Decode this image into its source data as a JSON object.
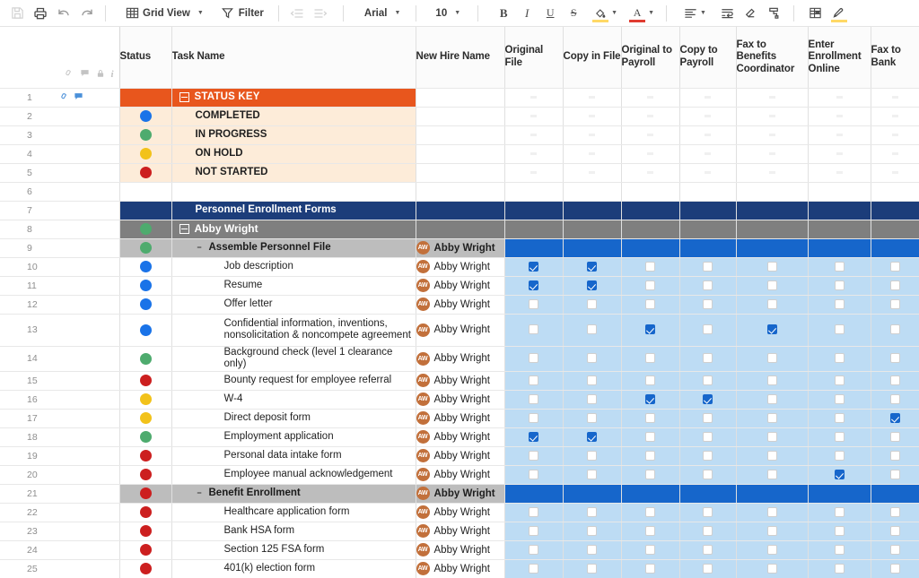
{
  "toolbar": {
    "icons": [
      {
        "name": "save-icon",
        "glyph": "💾"
      },
      {
        "name": "print-icon",
        "glyph": "⎙"
      },
      {
        "name": "undo-icon",
        "glyph": "↶"
      },
      {
        "name": "redo-icon",
        "glyph": "↷"
      }
    ],
    "view_label": "Grid View",
    "filter_label": "Filter",
    "indent_decrease_label": "Decrease indent",
    "indent_increase_label": "Increase indent",
    "font_family_label": "Arial",
    "font_size_label": "10",
    "bold_label": "B",
    "italic_label": "I",
    "underline_label": "U",
    "strikethrough_label": "S",
    "fill_color_label": "Fill color",
    "text_color_label": "Text color",
    "align_label": "Align",
    "wrap_label": "Wrap text",
    "clear_format_label": "Clear format",
    "format_painter_label": "Format painter",
    "card_view_label": "Card view",
    "highlight_label": "Highlighter"
  },
  "columns": [
    {
      "key": "gutter",
      "label": ""
    },
    {
      "key": "status",
      "label": "Status"
    },
    {
      "key": "task",
      "label": "Task Name"
    },
    {
      "key": "hire",
      "label": "New Hire Name"
    },
    {
      "key": "c1",
      "label": "Original File"
    },
    {
      "key": "c2",
      "label": "Copy in File"
    },
    {
      "key": "c3",
      "label": "Original to Payroll"
    },
    {
      "key": "c4",
      "label": "Copy to Payroll"
    },
    {
      "key": "c5",
      "label": "Fax to Benefits Coordinator"
    },
    {
      "key": "c6",
      "label": "Enter Enrollment Online"
    },
    {
      "key": "c7",
      "label": "Fax to Bank"
    }
  ],
  "gutter_header_icons": [
    "attachment-icon",
    "comment-icon",
    "lock-icon",
    "info-icon"
  ],
  "status_colors": {
    "completed": "#1a73e8",
    "in_progress": "#4eab6e",
    "on_hold": "#f2c21a",
    "not_started": "#cc1f1f"
  },
  "theme": {
    "orange_header": "#e8561d",
    "key_background": "#fdecd9",
    "navy_section": "#1c3d7a",
    "gray_section": "#7f7f7f",
    "light_gray_section": "#bdbdbd",
    "accent_blue": "#1666cb",
    "row_blue": "#bddcf4",
    "avatar_color": "#c2703b"
  },
  "rows": [
    {
      "num": "1",
      "theme": "r-orange",
      "icons": [
        "attachment-icon",
        "comment-icon"
      ],
      "toggle": "boxed-minus",
      "indent": 0,
      "task": "STATUS KEY",
      "status": null,
      "hire": null,
      "checks": "dash"
    },
    {
      "num": "2",
      "theme": "r-key",
      "indent": 1,
      "task": "COMPLETED",
      "status": "completed",
      "hire": null,
      "checks": "dash"
    },
    {
      "num": "3",
      "theme": "r-key",
      "indent": 1,
      "task": "IN PROGRESS",
      "status": "in_progress",
      "hire": null,
      "checks": "dash"
    },
    {
      "num": "4",
      "theme": "r-key",
      "indent": 1,
      "task": "ON HOLD",
      "status": "on_hold",
      "hire": null,
      "checks": "dash"
    },
    {
      "num": "5",
      "theme": "r-key",
      "indent": 1,
      "task": "NOT STARTED",
      "status": "not_started",
      "hire": null,
      "checks": "dash"
    },
    {
      "num": "6",
      "theme": "r-blank",
      "indent": 0,
      "task": "",
      "status": null,
      "hire": null,
      "checks": "none"
    },
    {
      "num": "7",
      "theme": "r-navy",
      "indent": 1,
      "task": "Personnel Enrollment Forms",
      "status": null,
      "hire": null,
      "checks": "none"
    },
    {
      "num": "8",
      "theme": "r-gray",
      "toggle": "boxed-minus",
      "indent": 0,
      "task": "Abby Wright",
      "status": "in_progress",
      "hire": null,
      "checks": "none"
    },
    {
      "num": "9",
      "theme": "r-lgray",
      "toggle": "plain-minus",
      "indent": 1,
      "task": "Assemble Personnel File",
      "status": "in_progress",
      "hire": "Abby Wright",
      "checks": "none"
    },
    {
      "num": "10",
      "theme": "r-item",
      "indent": 2,
      "task": "Job description",
      "status": "completed",
      "hire": "Abby Wright",
      "checks": [
        true,
        true,
        false,
        false,
        false,
        false,
        false
      ]
    },
    {
      "num": "11",
      "theme": "r-item",
      "indent": 2,
      "task": "Resume",
      "status": "completed",
      "hire": "Abby Wright",
      "checks": [
        true,
        true,
        false,
        false,
        false,
        false,
        false
      ]
    },
    {
      "num": "12",
      "theme": "r-item",
      "indent": 2,
      "task": "Offer letter",
      "status": "completed",
      "hire": "Abby Wright",
      "checks": [
        false,
        false,
        false,
        false,
        false,
        false,
        false
      ]
    },
    {
      "num": "13",
      "theme": "r-item",
      "indent": 2,
      "tall": true,
      "task": "Confidential information, inventions, nonsolicitation & noncompete agreement",
      "status": "completed",
      "hire": "Abby Wright",
      "checks": [
        false,
        false,
        true,
        false,
        true,
        false,
        false
      ]
    },
    {
      "num": "14",
      "theme": "r-item",
      "indent": 2,
      "task": "Background check (level 1 clearance only)",
      "status": "in_progress",
      "hire": "Abby Wright",
      "checks": [
        false,
        false,
        false,
        false,
        false,
        false,
        false
      ]
    },
    {
      "num": "15",
      "theme": "r-item",
      "indent": 2,
      "task": "Bounty request for employee referral",
      "status": "not_started",
      "hire": "Abby Wright",
      "checks": [
        false,
        false,
        false,
        false,
        false,
        false,
        false
      ]
    },
    {
      "num": "16",
      "theme": "r-item",
      "indent": 2,
      "task": "W-4",
      "status": "on_hold",
      "hire": "Abby Wright",
      "checks": [
        false,
        false,
        true,
        true,
        false,
        false,
        false
      ]
    },
    {
      "num": "17",
      "theme": "r-item",
      "indent": 2,
      "task": "Direct deposit form",
      "status": "on_hold",
      "hire": "Abby Wright",
      "checks": [
        false,
        false,
        false,
        false,
        false,
        false,
        true
      ]
    },
    {
      "num": "18",
      "theme": "r-item",
      "indent": 2,
      "task": "Employment application",
      "status": "in_progress",
      "hire": "Abby Wright",
      "checks": [
        true,
        true,
        false,
        false,
        false,
        false,
        false
      ]
    },
    {
      "num": "19",
      "theme": "r-item",
      "indent": 2,
      "task": "Personal data intake form",
      "status": "not_started",
      "hire": "Abby Wright",
      "checks": [
        false,
        false,
        false,
        false,
        false,
        false,
        false
      ]
    },
    {
      "num": "20",
      "theme": "r-item",
      "indent": 2,
      "task": "Employee manual acknowledgement",
      "status": "not_started",
      "hire": "Abby Wright",
      "checks": [
        false,
        false,
        false,
        false,
        false,
        true,
        false
      ]
    },
    {
      "num": "21",
      "theme": "r-lgray",
      "toggle": "plain-minus",
      "indent": 1,
      "task": "Benefit Enrollment",
      "status": "not_started",
      "hire": "Abby Wright",
      "checks": "none"
    },
    {
      "num": "22",
      "theme": "r-item",
      "indent": 2,
      "task": "Healthcare application form",
      "status": "not_started",
      "hire": "Abby Wright",
      "checks": [
        false,
        false,
        false,
        false,
        false,
        false,
        false
      ]
    },
    {
      "num": "23",
      "theme": "r-item",
      "indent": 2,
      "task": "Bank HSA form",
      "status": "not_started",
      "hire": "Abby Wright",
      "checks": [
        false,
        false,
        false,
        false,
        false,
        false,
        false
      ]
    },
    {
      "num": "24",
      "theme": "r-item",
      "indent": 2,
      "task": "Section 125 FSA form",
      "status": "not_started",
      "hire": "Abby Wright",
      "checks": [
        false,
        false,
        false,
        false,
        false,
        false,
        false
      ]
    },
    {
      "num": "25",
      "theme": "r-item",
      "indent": 2,
      "task": "401(k) election form",
      "status": "not_started",
      "hire": "Abby Wright",
      "checks": [
        false,
        false,
        false,
        false,
        false,
        false,
        false
      ]
    }
  ],
  "avatar_initials": "AW"
}
